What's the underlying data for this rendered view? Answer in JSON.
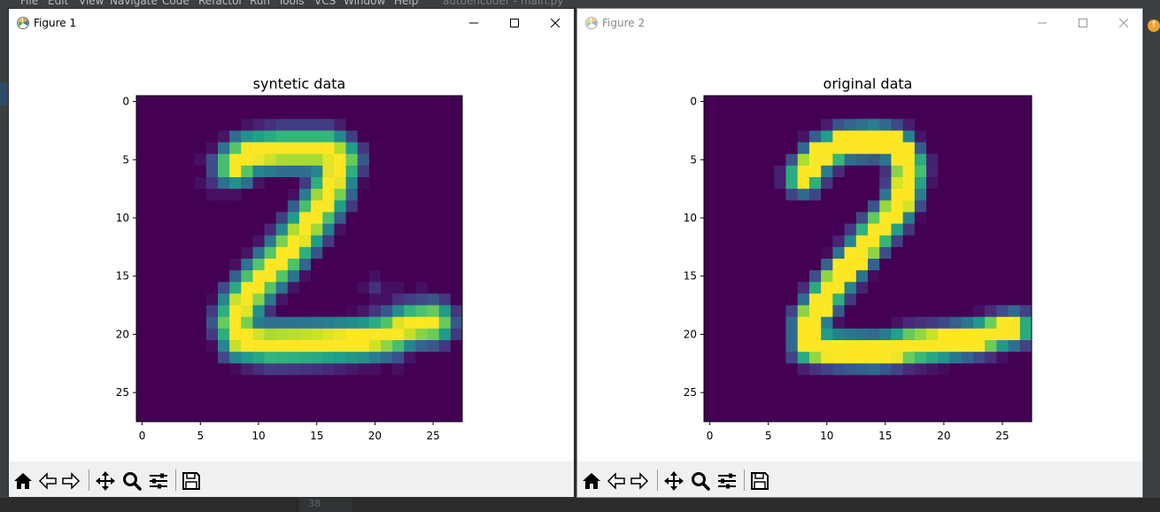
{
  "ide": {
    "menu": [
      "File",
      "Edit",
      "View",
      "Navigate",
      "Code",
      "Refactor",
      "Run",
      "Tools",
      "VCS",
      "Window",
      "Help"
    ],
    "project_title": "autoencoder - main.py",
    "line_number": "38"
  },
  "windows": [
    {
      "title": "Figure 1",
      "toolbar": [
        "home-icon",
        "back-icon",
        "forward-icon",
        "pan-icon",
        "zoom-icon",
        "configure-subplots-icon",
        "save-icon"
      ],
      "active": true
    },
    {
      "title": "Figure 2",
      "toolbar": [
        "home-icon",
        "back-icon",
        "forward-icon",
        "pan-icon",
        "zoom-icon",
        "configure-subplots-icon",
        "save-icon"
      ],
      "active": false
    }
  ],
  "chart_data": [
    {
      "type": "heatmap",
      "title": "syntetic data",
      "xlabel": "",
      "ylabel": "",
      "xlim": [
        -0.5,
        27.5
      ],
      "ylim": [
        27.5,
        -0.5
      ],
      "xticks": [
        "0",
        "5",
        "10",
        "15",
        "20",
        "25"
      ],
      "yticks": [
        "0",
        "5",
        "10",
        "15",
        "20",
        "25"
      ],
      "colormap": "viridis",
      "rows": 28,
      "cols": 28,
      "segments": [
        [
          [
            8,
            5.5
          ],
          [
            9,
            4.5
          ],
          [
            12,
            4.2
          ],
          [
            16,
            4.2
          ],
          [
            17,
            5
          ]
        ],
        [
          [
            17,
            5
          ],
          [
            16,
            8
          ],
          [
            14,
            11
          ],
          [
            12,
            13.5
          ],
          [
            10,
            15.5
          ],
          [
            8.5,
            17.5
          ],
          [
            8,
            19
          ],
          [
            8.5,
            20.5
          ]
        ],
        [
          [
            8.5,
            20.5
          ],
          [
            11,
            20.8
          ],
          [
            15,
            20.7
          ],
          [
            19,
            20.5
          ],
          [
            21.5,
            20
          ],
          [
            23,
            19.2
          ],
          [
            25,
            19
          ]
        ]
      ],
      "halo": [
        [
          6,
          5
        ],
        [
          7,
          4
        ],
        [
          6,
          7
        ],
        [
          7,
          7
        ],
        [
          20,
          16
        ],
        [
          22,
          17
        ],
        [
          24,
          17
        ],
        [
          25,
          18
        ],
        [
          26,
          19
        ],
        [
          20,
          22
        ],
        [
          22,
          22
        ],
        [
          15,
          22
        ],
        [
          17,
          22
        ]
      ]
    },
    {
      "type": "heatmap",
      "title": "original data",
      "xlabel": "",
      "ylabel": "",
      "xlim": [
        -0.5,
        27.5
      ],
      "ylim": [
        27.5,
        -0.5
      ],
      "xticks": [
        "0",
        "5",
        "10",
        "15",
        "20",
        "25"
      ],
      "yticks": [
        "0",
        "5",
        "10",
        "15",
        "20",
        "25"
      ],
      "colormap": "viridis",
      "rows": 28,
      "cols": 28,
      "segments": [
        [
          [
            8,
            6.5
          ],
          [
            9.5,
            4.5
          ],
          [
            11.5,
            3.6
          ],
          [
            14,
            3.3
          ],
          [
            16,
            3.8
          ],
          [
            17,
            5.5
          ],
          [
            16.8,
            7.5
          ]
        ],
        [
          [
            16.8,
            7.5
          ],
          [
            15.8,
            9.5
          ],
          [
            14,
            11.5
          ],
          [
            12,
            14
          ],
          [
            10,
            16.5
          ],
          [
            8.5,
            19
          ],
          [
            8.5,
            21
          ]
        ],
        [
          [
            8.5,
            21
          ],
          [
            11,
            21.3
          ],
          [
            14,
            21.5
          ],
          [
            17,
            21
          ],
          [
            20,
            20.8
          ],
          [
            22.5,
            20.3
          ],
          [
            25,
            19.8
          ],
          [
            26,
            19.5
          ]
        ]
      ],
      "halo": []
    }
  ]
}
